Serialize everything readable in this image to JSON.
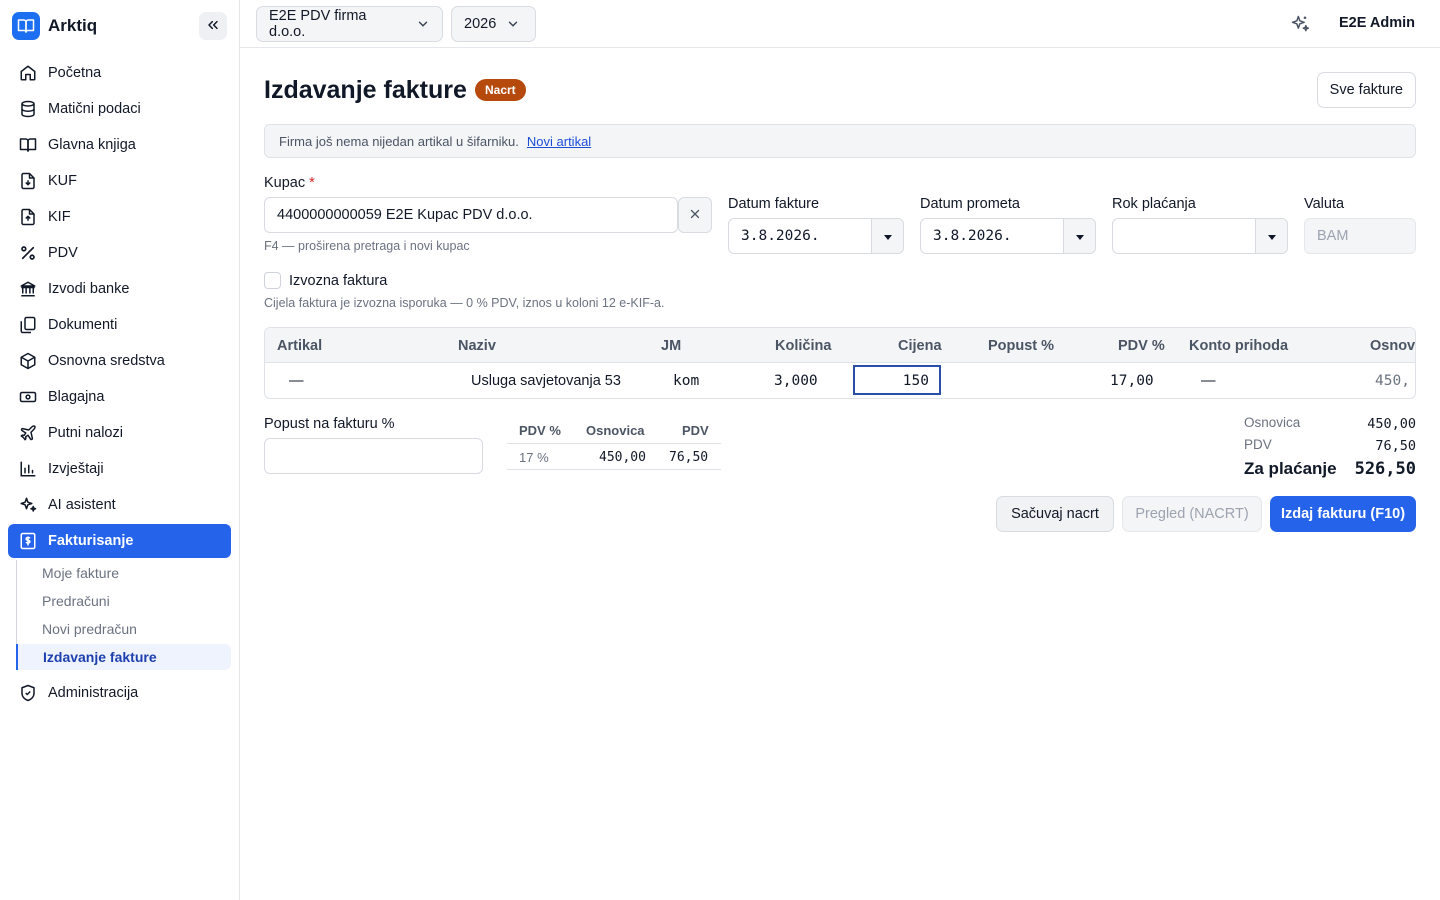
{
  "app": {
    "name": "Arktiq"
  },
  "sidebar": {
    "items": [
      {
        "label": "Početna",
        "icon": "home-icon"
      },
      {
        "label": "Matični podaci",
        "icon": "database-icon"
      },
      {
        "label": "Glavna knjiga",
        "icon": "book-icon"
      },
      {
        "label": "KUF",
        "icon": "file-in-icon"
      },
      {
        "label": "KIF",
        "icon": "file-out-icon"
      },
      {
        "label": "PDV",
        "icon": "percent-icon"
      },
      {
        "label": "Izvodi banke",
        "icon": "bank-icon"
      },
      {
        "label": "Dokumenti",
        "icon": "documents-icon"
      },
      {
        "label": "Osnovna sredstva",
        "icon": "box-icon"
      },
      {
        "label": "Blagajna",
        "icon": "cash-icon"
      },
      {
        "label": "Putni nalozi",
        "icon": "plane-icon"
      },
      {
        "label": "Izvještaji",
        "icon": "chart-icon"
      },
      {
        "label": "AI asistent",
        "icon": "sparkle-icon"
      },
      {
        "label": "Fakturisanje",
        "icon": "invoice-icon"
      }
    ],
    "subitems": [
      {
        "label": "Moje fakture"
      },
      {
        "label": "Predračuni"
      },
      {
        "label": "Novi predračun"
      },
      {
        "label": "Izdavanje fakture"
      }
    ],
    "admin": {
      "label": "Administracija",
      "icon": "shield-icon"
    }
  },
  "topbar": {
    "company": "E2E PDV firma d.o.o.",
    "year": "2026",
    "user": "E2E Admin"
  },
  "page": {
    "title": "Izdavanje fakture",
    "status_badge": "Nacrt",
    "all_invoices_button": "Sve fakture",
    "notice_text": "Firma još nema nijedan artikal u šifarniku.",
    "notice_link": "Novi artikal"
  },
  "form": {
    "customer_label": "Kupac",
    "required_mark": "*",
    "customer_value": "4400000000059 E2E Kupac PDV d.o.o.",
    "customer_hint": "F4 — proširena pretraga i novi kupac",
    "invoice_date_label": "Datum fakture",
    "invoice_date": "3.8.2026.",
    "turnover_date_label": "Datum prometa",
    "turnover_date": "3.8.2026.",
    "due_date_label": "Rok plaćanja",
    "due_date": "",
    "currency_label": "Valuta",
    "currency": "BAM",
    "export_label": "Izvozna faktura",
    "export_hint": "Cijela faktura je izvozna isporuka — 0 % PDV, iznos u koloni 12 e-KIF-a."
  },
  "lines": {
    "headers": [
      "Artikal",
      "Naziv",
      "JM",
      "Količina",
      "Cijena",
      "Popust %",
      "PDV %",
      "Konto prihoda",
      "Osnov:"
    ],
    "row": {
      "artikal": "—",
      "naziv": "Usluga savjetovanja 53",
      "jm": "kom",
      "kolicina": "3,000",
      "cijena": "150",
      "popust": "",
      "pdv": "17,00",
      "konto": "—",
      "osnovica": "450,"
    }
  },
  "discount": {
    "label": "Popust na fakturu %",
    "value": ""
  },
  "vat_summary": {
    "headers": [
      "PDV %",
      "Osnovica",
      "PDV"
    ],
    "row": [
      "17 %",
      "450,00",
      "76,50"
    ]
  },
  "totals": {
    "base_label": "Osnovica",
    "base": "450,00",
    "vat_label": "PDV",
    "vat": "76,50",
    "total_label": "Za plaćanje",
    "total": "526,50"
  },
  "actions": {
    "save": "Sačuvaj nacrt",
    "preview": "Pregled (NACRT)",
    "issue": "Izdaj fakturu (F10)"
  }
}
